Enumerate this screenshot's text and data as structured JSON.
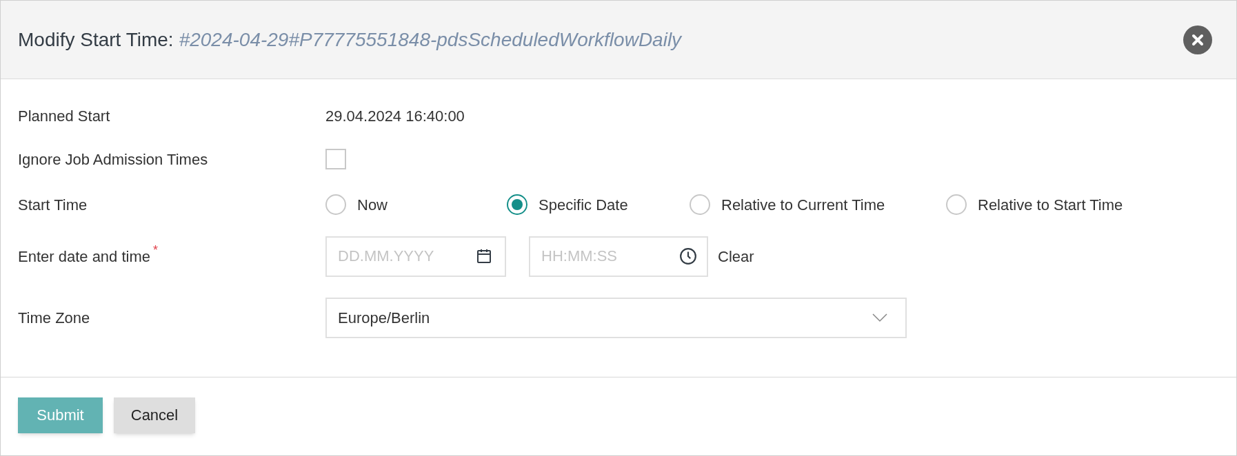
{
  "dialog": {
    "title": "Modify Start Time:",
    "subject": "#2024-04-29#P77775551848-pdsScheduledWorkflowDaily"
  },
  "fields": [
    {
      "kind": "text",
      "label": "Planned Start",
      "value": "29.04.2024 16:40:00"
    },
    {
      "kind": "checkbox",
      "label": "Ignore Job Admission Times",
      "checked": false
    },
    {
      "kind": "radio",
      "label": "Start Time",
      "options": [
        {
          "label": "Now",
          "selected": false
        },
        {
          "label": "Specific Date",
          "selected": true
        },
        {
          "label": "Relative to Current Time",
          "selected": false
        },
        {
          "label": "Relative to Start Time",
          "selected": false
        }
      ]
    },
    {
      "kind": "datetime",
      "label": "Enter date and time",
      "required": true,
      "required_mark": "*",
      "date_placeholder": "DD.MM.YYYY",
      "time_placeholder": "HH:MM:SS",
      "clear": "Clear"
    },
    {
      "kind": "select",
      "label": "Time Zone",
      "value": "Europe/Berlin"
    }
  ],
  "buttons": [
    {
      "label": "Submit",
      "kind": "primary"
    },
    {
      "label": "Cancel",
      "kind": "secondary"
    }
  ]
}
